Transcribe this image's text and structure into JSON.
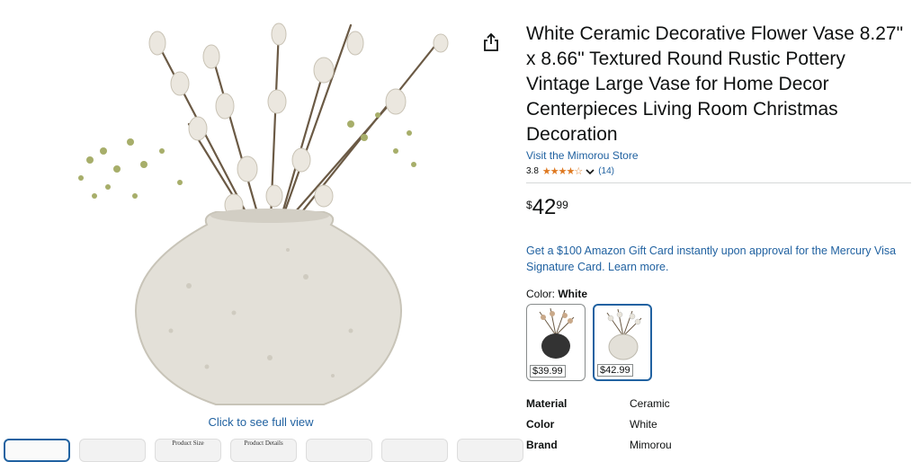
{
  "gallery": {
    "click_to_full": "Click to see full view",
    "thumbnails": [
      {
        "label": ""
      },
      {
        "label": ""
      },
      {
        "label": "Product Size"
      },
      {
        "label": "Product Details"
      },
      {
        "label": ""
      },
      {
        "label": ""
      },
      {
        "label": ""
      }
    ]
  },
  "product": {
    "title": "White Ceramic Decorative Flower Vase 8.27\" x 8.66\" Textured Round Rustic Pottery Vintage Large Vase for Home Decor Centerpieces Living Room Christmas Decoration",
    "store_link": "Visit the Mimorou Store",
    "rating_value": "3.8",
    "stars_display": "★★★★☆",
    "review_count": "(14)",
    "price": {
      "symbol": "$",
      "whole": "42",
      "fraction": "99"
    },
    "promo": "Get a $100 Amazon Gift Card instantly upon approval for the Mercury Visa Signature Card. Learn more.",
    "color_label": "Color:",
    "color_value": "White",
    "swatches": [
      {
        "price": "$39.99",
        "color": "black"
      },
      {
        "price": "$42.99",
        "color": "white"
      }
    ],
    "specs": [
      {
        "key": "Material",
        "value": "Ceramic"
      },
      {
        "key": "Color",
        "value": "White"
      },
      {
        "key": "Brand",
        "value": "Mimorou"
      }
    ]
  },
  "icons": {
    "share": "share-icon",
    "dropdown": "chevron-down-icon"
  },
  "colors": {
    "link": "#2162a1",
    "star": "#de7921",
    "selected_border": "#2162a1"
  }
}
